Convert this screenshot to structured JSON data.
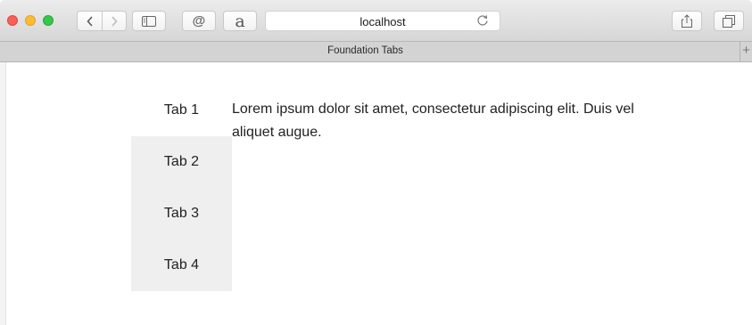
{
  "browser": {
    "url": "localhost",
    "tab_title": "Foundation Tabs",
    "new_tab_symbol": "+",
    "ext1_glyph": "@",
    "ext2_glyph": "a",
    "icons": [
      "back-icon",
      "forward-icon",
      "sidebar-icon",
      "reload-icon",
      "share-icon",
      "tabs-overview-icon"
    ]
  },
  "page": {
    "tabs": [
      {
        "label": "Tab 1",
        "active": true
      },
      {
        "label": "Tab 2",
        "active": false
      },
      {
        "label": "Tab 3",
        "active": false
      },
      {
        "label": "Tab 4",
        "active": false
      }
    ],
    "panel_text": "Lorem ipsum dolor sit amet, consectetur adipiscing elit. Duis vel aliquet augue."
  },
  "colors": {
    "inactive_tab_bg": "#efefef",
    "active_tab_bg": "#ffffff",
    "close_light": "#fc5f57",
    "minimize_light": "#fdbc2e",
    "zoom_light": "#34c84a"
  }
}
